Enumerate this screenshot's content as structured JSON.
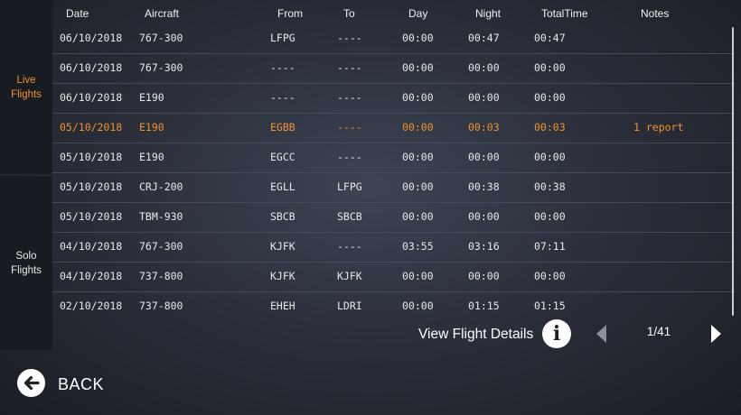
{
  "sidebar": {
    "live_tab": {
      "line1": "Live",
      "line2": "Flights",
      "color": "#f0922e"
    },
    "solo_tab": {
      "line1": "Solo",
      "line2": "Flights"
    }
  },
  "columns": {
    "date": "Date",
    "aircraft": "Aircraft",
    "from": "From",
    "to": "To",
    "day": "Day",
    "night": "Night",
    "total": "TotalTime",
    "notes": "Notes"
  },
  "rows": [
    {
      "date": "06/10/2018",
      "aircraft": "767-300",
      "from": "LFPG",
      "to": "----",
      "day": "00:00",
      "night": "00:47",
      "total": "00:47",
      "notes": ""
    },
    {
      "date": "06/10/2018",
      "aircraft": "767-300",
      "from": "----",
      "to": "----",
      "day": "00:00",
      "night": "00:00",
      "total": "00:00",
      "notes": ""
    },
    {
      "date": "06/10/2018",
      "aircraft": "E190",
      "from": "----",
      "to": "----",
      "day": "00:00",
      "night": "00:00",
      "total": "00:00",
      "notes": ""
    },
    {
      "date": "05/10/2018",
      "aircraft": "E190",
      "from": "EGBB",
      "to": "----",
      "day": "00:00",
      "night": "00:03",
      "total": "00:03",
      "notes": "1 report"
    },
    {
      "date": "05/10/2018",
      "aircraft": "E190",
      "from": "EGCC",
      "to": "----",
      "day": "00:00",
      "night": "00:00",
      "total": "00:00",
      "notes": ""
    },
    {
      "date": "05/10/2018",
      "aircraft": "CRJ-200",
      "from": "EGLL",
      "to": "LFPG",
      "day": "00:00",
      "night": "00:38",
      "total": "00:38",
      "notes": ""
    },
    {
      "date": "05/10/2018",
      "aircraft": "TBM-930",
      "from": "SBCB",
      "to": "SBCB",
      "day": "00:00",
      "night": "00:00",
      "total": "00:00",
      "notes": ""
    },
    {
      "date": "04/10/2018",
      "aircraft": "767-300",
      "from": "KJFK",
      "to": "----",
      "day": "03:55",
      "night": "03:16",
      "total": "07:11",
      "notes": ""
    },
    {
      "date": "04/10/2018",
      "aircraft": "737-800",
      "from": "KJFK",
      "to": "KJFK",
      "day": "00:00",
      "night": "00:00",
      "total": "00:00",
      "notes": ""
    },
    {
      "date": "02/10/2018",
      "aircraft": "737-800",
      "from": "EHEH",
      "to": "LDRI",
      "day": "00:00",
      "night": "01:15",
      "total": "01:15",
      "notes": ""
    }
  ],
  "footer": {
    "view_details_label": "View Flight Details",
    "info_icon": "info-icon",
    "page_indicator": "1/41",
    "back_label": "BACK"
  }
}
